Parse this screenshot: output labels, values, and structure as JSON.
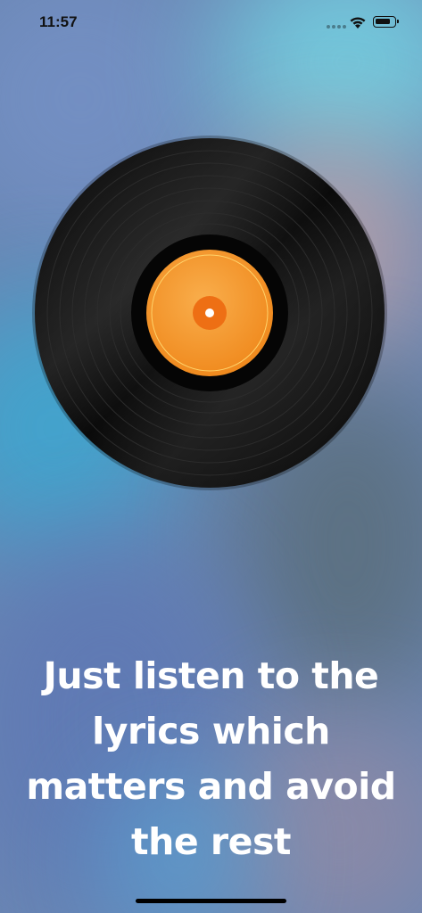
{
  "status_bar": {
    "time": "11:57",
    "icons": [
      "signal-dots-icon",
      "wifi-icon",
      "battery-icon"
    ]
  },
  "record": {
    "icon": "vinyl-record-icon",
    "label_color": "#F7A13A",
    "disc_color": "#111111"
  },
  "onboarding": {
    "caption": "Just listen to the lyrics which matters and avoid the rest"
  }
}
